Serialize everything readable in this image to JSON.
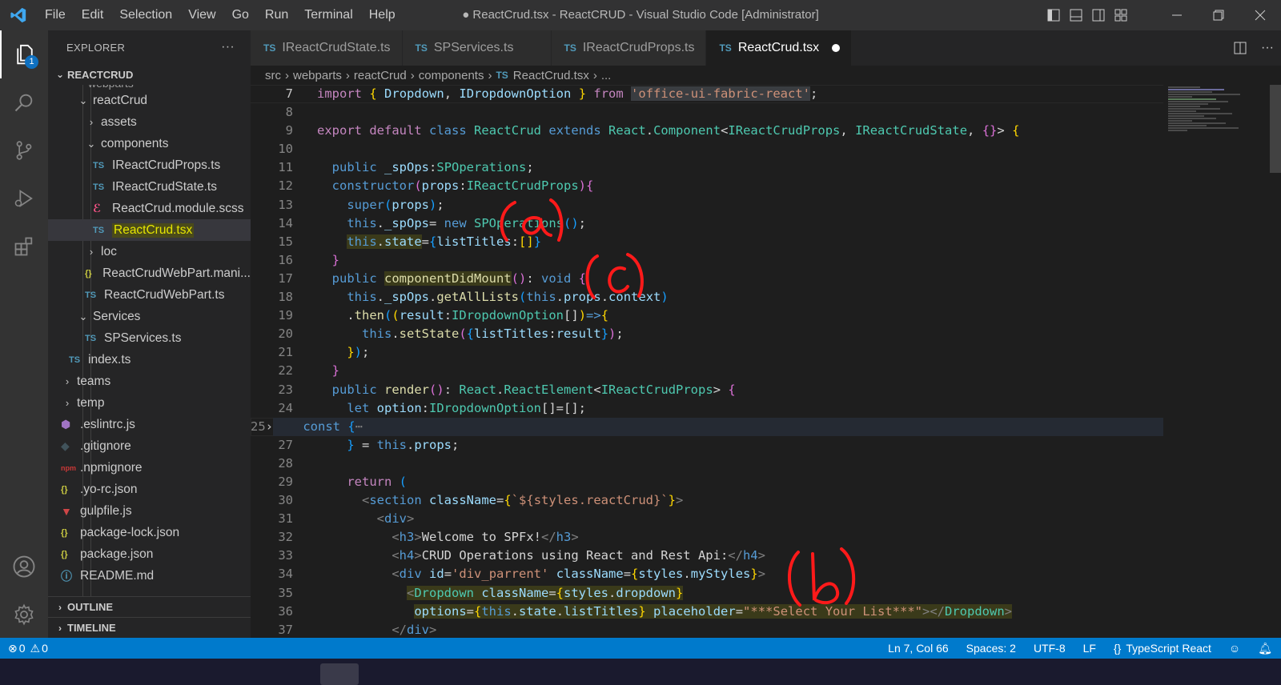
{
  "title_bar": {
    "menu": [
      "File",
      "Edit",
      "Selection",
      "View",
      "Go",
      "Run",
      "Terminal",
      "Help"
    ],
    "window_title": "● ReactCrud.tsx - ReactCRUD - Visual Studio Code [Administrator]"
  },
  "activity_bar": {
    "explorer_badge": "1"
  },
  "sidebar": {
    "header": "EXPLORER",
    "more": "···",
    "workspace": "REACTCRUD",
    "partial_top": "webparts",
    "items": [
      {
        "label": "reactCrud",
        "kind": "folder-open"
      },
      {
        "label": "assets",
        "kind": "folder"
      },
      {
        "label": "components",
        "kind": "folder-open"
      },
      {
        "label": "IReactCrudProps.ts",
        "kind": "ts",
        "icon_text": "TS"
      },
      {
        "label": "IReactCrudState.ts",
        "kind": "ts",
        "icon_text": "TS"
      },
      {
        "label": "ReactCrud.module.scss",
        "kind": "scss"
      },
      {
        "label": "ReactCrud.tsx",
        "kind": "tsx",
        "icon_text": "TS"
      },
      {
        "label": "loc",
        "kind": "folder"
      },
      {
        "label": "ReactCrudWebPart.mani...",
        "kind": "json",
        "icon_text": "{}"
      },
      {
        "label": "ReactCrudWebPart.ts",
        "kind": "ts",
        "icon_text": "TS"
      },
      {
        "label": "Services",
        "kind": "folder-open"
      },
      {
        "label": "SPServices.ts",
        "kind": "ts",
        "icon_text": "TS"
      },
      {
        "label": "index.ts",
        "kind": "ts",
        "icon_text": "TS"
      },
      {
        "label": "teams",
        "kind": "folder"
      },
      {
        "label": "temp",
        "kind": "folder"
      },
      {
        "label": ".eslintrc.js",
        "kind": "eslint"
      },
      {
        "label": ".gitignore",
        "kind": "git"
      },
      {
        "label": ".npmignore",
        "kind": "npm",
        "icon_text": "npm"
      },
      {
        "label": ".yo-rc.json",
        "kind": "json",
        "icon_text": "{}"
      },
      {
        "label": "gulpfile.js",
        "kind": "gulp"
      },
      {
        "label": "package-lock.json",
        "kind": "json",
        "icon_text": "{}"
      },
      {
        "label": "package.json",
        "kind": "json",
        "icon_text": "{}"
      },
      {
        "label": "README.md",
        "kind": "info"
      }
    ],
    "outline": "OUTLINE",
    "timeline": "TIMELINE"
  },
  "tabs": [
    {
      "label": "IReactCrudState.ts",
      "icon_text": "TS"
    },
    {
      "label": "SPServices.ts",
      "icon_text": "TS"
    },
    {
      "label": "IReactCrudProps.ts",
      "icon_text": "TS"
    },
    {
      "label": "ReactCrud.tsx",
      "icon_text": "TS",
      "active": true,
      "modified": true
    }
  ],
  "breadcrumb": {
    "parts": [
      "src",
      "webparts",
      "reactCrud",
      "components"
    ],
    "file_icon": "TS",
    "file": "ReactCrud.tsx",
    "more": "..."
  },
  "code": {
    "line_numbers": [
      "7",
      "8",
      "9",
      "10",
      "11",
      "12",
      "13",
      "14",
      "15",
      "16",
      "17",
      "18",
      "19",
      "20",
      "21",
      "22",
      "23",
      "24",
      "25",
      "27",
      "28",
      "29",
      "30",
      "31",
      "32",
      "33",
      "34",
      "35",
      "36",
      "37"
    ],
    "strings": {
      "fabric": "'office-ui-fabric-react'",
      "tpl": "`${styles.reactCrud}`",
      "id": "'div_parrent'",
      "placeholder": "\"***Select Your List***\""
    },
    "jsx_text": {
      "h3": "Welcome to SPFx!",
      "h4": "CRUD Operations using React and Rest Api:"
    }
  },
  "status_bar": {
    "errors": "0",
    "warnings": "0",
    "position": "Ln 7, Col 66",
    "spaces": "Spaces: 2",
    "encoding": "UTF-8",
    "eol": "LF",
    "language": "TypeScript React"
  },
  "annotations": [
    "(a)",
    "(b)",
    "(c)"
  ]
}
